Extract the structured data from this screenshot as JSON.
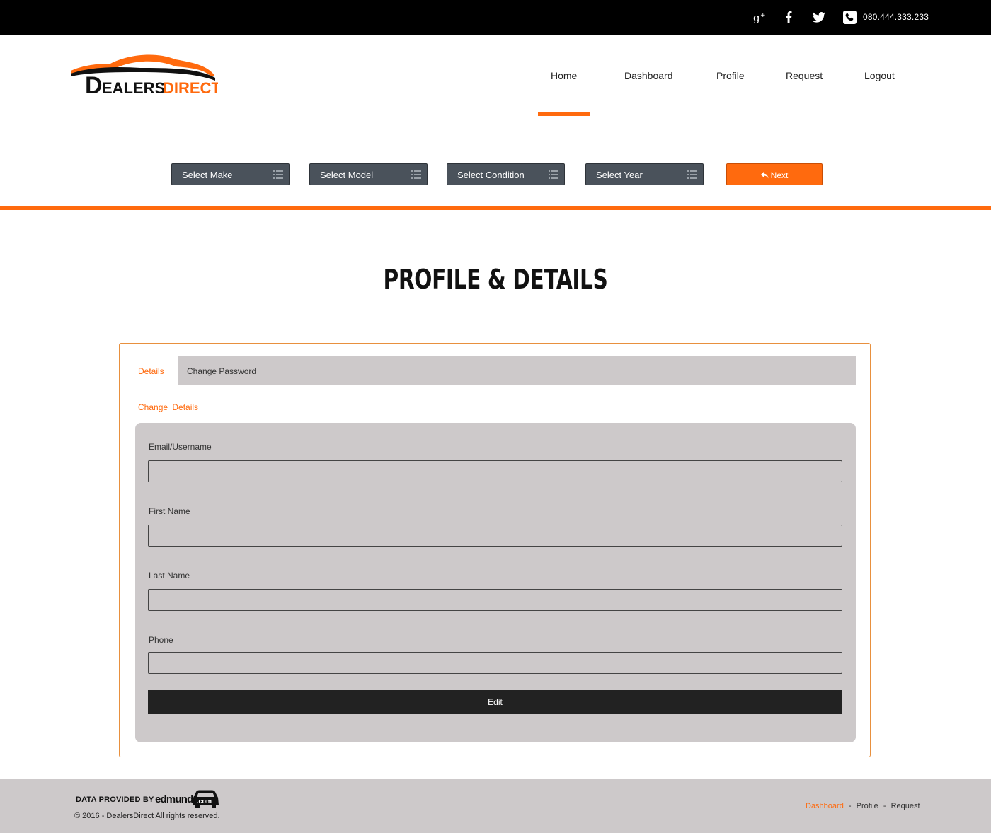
{
  "topbar": {
    "phone": "080.444.333.233",
    "icons": [
      "google-plus-icon",
      "facebook-icon",
      "twitter-icon",
      "phone-icon"
    ]
  },
  "brand": {
    "name_first": "D",
    "name_rest": "EALERS",
    "name_second": "DIRECT",
    "colors": {
      "accent": "#ff6a0e",
      "dark": "#222222"
    }
  },
  "nav": {
    "items": [
      {
        "label": "Home",
        "active": true
      },
      {
        "label": "Dashboard"
      },
      {
        "label": "Profile"
      },
      {
        "label": "Request"
      },
      {
        "label": "Logout"
      }
    ]
  },
  "search": {
    "make": "Select Make",
    "model": "Select Model",
    "condition": "Select Condition",
    "year": "Select Year",
    "next": "Next"
  },
  "page": {
    "title": "PROFILE & DETAILS"
  },
  "tabs": {
    "details": "Details",
    "change_password": "Change Password"
  },
  "form": {
    "heading": "Change  Details",
    "fields": [
      {
        "label": "Email/Username",
        "value": ""
      },
      {
        "label": "First Name",
        "value": ""
      },
      {
        "label": "Last Name",
        "value": ""
      },
      {
        "label": "Phone",
        "value": ""
      }
    ],
    "edit_label": "Edit"
  },
  "footer": {
    "data_provided_by": "DATA PROVIDED BY",
    "provider": "edmunds",
    "provider_suffix": ".com",
    "copyright": "© 2016 - DealersDirect All rights reserved.",
    "links": [
      {
        "label": "Dashboard",
        "active": true
      },
      {
        "label": "Profile"
      },
      {
        "label": "Request"
      }
    ],
    "separator": "-"
  }
}
